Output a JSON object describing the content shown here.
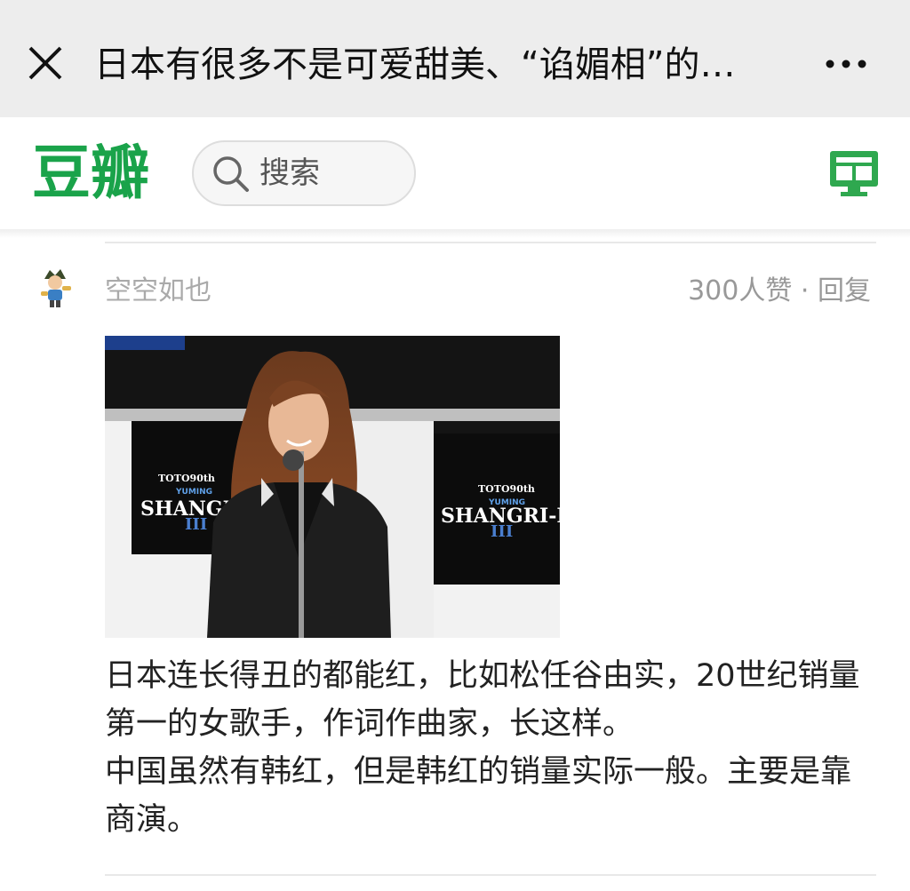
{
  "topbar": {
    "title": "日本有很多不是可爱甜美、“谄媚相”的…",
    "close_icon": "close-icon",
    "more_icon": "more-dots-icon"
  },
  "header": {
    "logo": "豆瓣",
    "search_placeholder": "搜索",
    "desktop_icon": "desktop-monitor-icon",
    "brand_color": "#1aa34a"
  },
  "comment": {
    "username": "空空如也",
    "likes": "300人赞",
    "separator": "·",
    "reply": "回复",
    "photo": {
      "logo_top": "TOTO90th",
      "logo_mid": "YUMING",
      "logo_main": "SHANGRI-LA",
      "logo_numeral": "III"
    },
    "paragraphs": [
      "日本连长得丑的都能红，比如松任谷由实，20世纪销量第一的女歌手，作词作曲家，长这样。",
      "中国虽然有韩红，但是韩红的销量实际一般。主要是靠商演。"
    ]
  }
}
